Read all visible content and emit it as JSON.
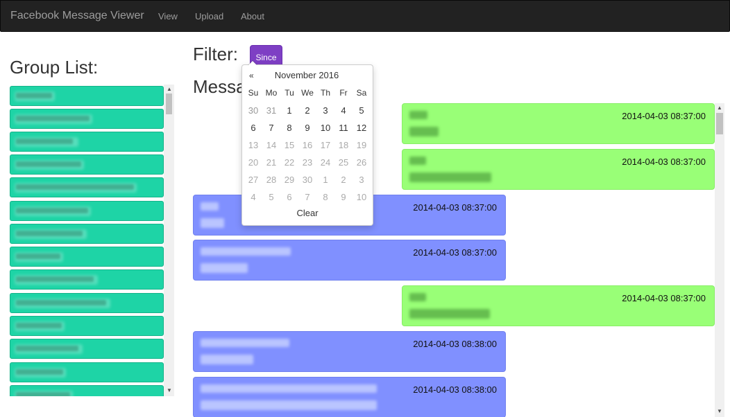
{
  "navbar": {
    "brand": "Facebook Message Viewer",
    "links": [
      "View",
      "Upload",
      "About"
    ]
  },
  "groups": {
    "title": "Group List:",
    "items": [
      "",
      "",
      "",
      "",
      "",
      "",
      "",
      "",
      "",
      "",
      "",
      "",
      "",
      ""
    ]
  },
  "filter": {
    "label": "Filter:",
    "since_button": "Since"
  },
  "messages": {
    "title": "Messa",
    "items": [
      {
        "side": "right",
        "color": "green",
        "timestamp": "2014-04-03 08:37:00"
      },
      {
        "side": "right",
        "color": "green",
        "timestamp": "2014-04-03 08:37:00"
      },
      {
        "side": "left",
        "color": "blue",
        "timestamp": "2014-04-03 08:37:00"
      },
      {
        "side": "left",
        "color": "blue",
        "timestamp": "2014-04-03 08:37:00"
      },
      {
        "side": "right",
        "color": "green",
        "timestamp": "2014-04-03 08:37:00"
      },
      {
        "side": "left",
        "color": "blue",
        "timestamp": "2014-04-03 08:38:00"
      },
      {
        "side": "left",
        "color": "blue",
        "timestamp": "2014-04-03 08:38:00"
      }
    ]
  },
  "datepicker": {
    "prev": "«",
    "month": "November 2016",
    "weekdays": [
      "Su",
      "Mo",
      "Tu",
      "We",
      "Th",
      "Fr",
      "Sa"
    ],
    "weeks": [
      [
        "30",
        "31",
        "1",
        "2",
        "3",
        "4",
        "5"
      ],
      [
        "6",
        "7",
        "8",
        "9",
        "10",
        "11",
        "12"
      ],
      [
        "13",
        "14",
        "15",
        "16",
        "17",
        "18",
        "19"
      ],
      [
        "20",
        "21",
        "22",
        "23",
        "24",
        "25",
        "26"
      ],
      [
        "27",
        "28",
        "29",
        "30",
        "1",
        "2",
        "3"
      ],
      [
        "4",
        "5",
        "6",
        "7",
        "8",
        "9",
        "10"
      ]
    ],
    "clear": "Clear"
  },
  "colors": {
    "group_item": "#1ed4a6",
    "msg_green": "#99ff77",
    "msg_blue": "#8090ff",
    "since_button": "#7e3fc4",
    "navbar": "#222222"
  }
}
